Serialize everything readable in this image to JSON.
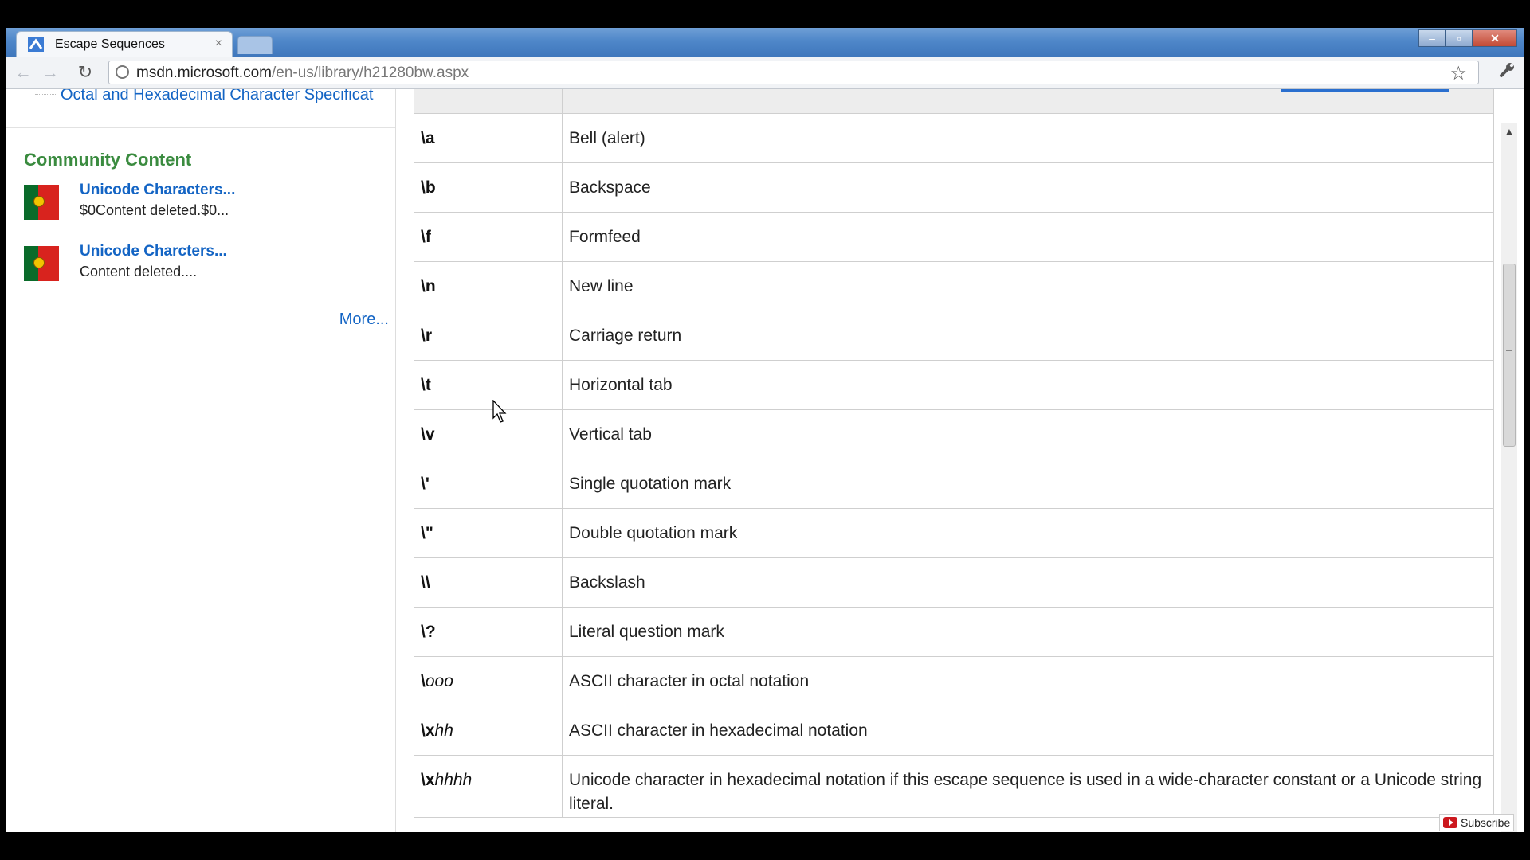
{
  "browser": {
    "tab_title": "Escape Sequences",
    "tab_close": "×",
    "url_host": "msdn.microsoft.com",
    "url_path": "/en-us/library/h21280bw.aspx"
  },
  "sidebar": {
    "toc_item": "Octal and Hexadecimal Character Specificat",
    "community_title": "Community Content",
    "community_items": [
      {
        "title": "Unicode Characters...",
        "desc": "$0Content deleted.$0..."
      },
      {
        "title": "Unicode Charcters...",
        "desc": "Content deleted...."
      }
    ],
    "more_link": "More..."
  },
  "table": {
    "rows": [
      {
        "seq": "\\a",
        "seq_italic": "",
        "desc": "Bell (alert)"
      },
      {
        "seq": "\\b",
        "seq_italic": "",
        "desc": "Backspace"
      },
      {
        "seq": "\\f",
        "seq_italic": "",
        "desc": "Formfeed"
      },
      {
        "seq": "\\n",
        "seq_italic": "",
        "desc": "New line"
      },
      {
        "seq": "\\r",
        "seq_italic": "",
        "desc": "Carriage return"
      },
      {
        "seq": "\\t",
        "seq_italic": "",
        "desc": "Horizontal tab"
      },
      {
        "seq": "\\v",
        "seq_italic": "",
        "desc": "Vertical tab"
      },
      {
        "seq": "\\'",
        "seq_italic": "",
        "desc": "Single quotation mark"
      },
      {
        "seq": "\\\"",
        "seq_italic": "",
        "desc": "Double quotation mark"
      },
      {
        "seq": "\\\\",
        "seq_italic": "",
        "desc": "Backslash"
      },
      {
        "seq": "\\?",
        "seq_italic": "",
        "desc": "Literal question mark"
      },
      {
        "seq": "\\",
        "seq_italic": "ooo",
        "desc": "ASCII character in octal notation"
      },
      {
        "seq": "\\x",
        "seq_italic": "hh",
        "desc": "ASCII character in hexadecimal notation"
      },
      {
        "seq": "\\x",
        "seq_italic": "hhhh",
        "desc": "Unicode character in hexadecimal notation if this escape sequence is used in a wide-character constant or a Unicode string literal."
      }
    ]
  },
  "overlay": {
    "subscribe_label": "Subscribe"
  }
}
